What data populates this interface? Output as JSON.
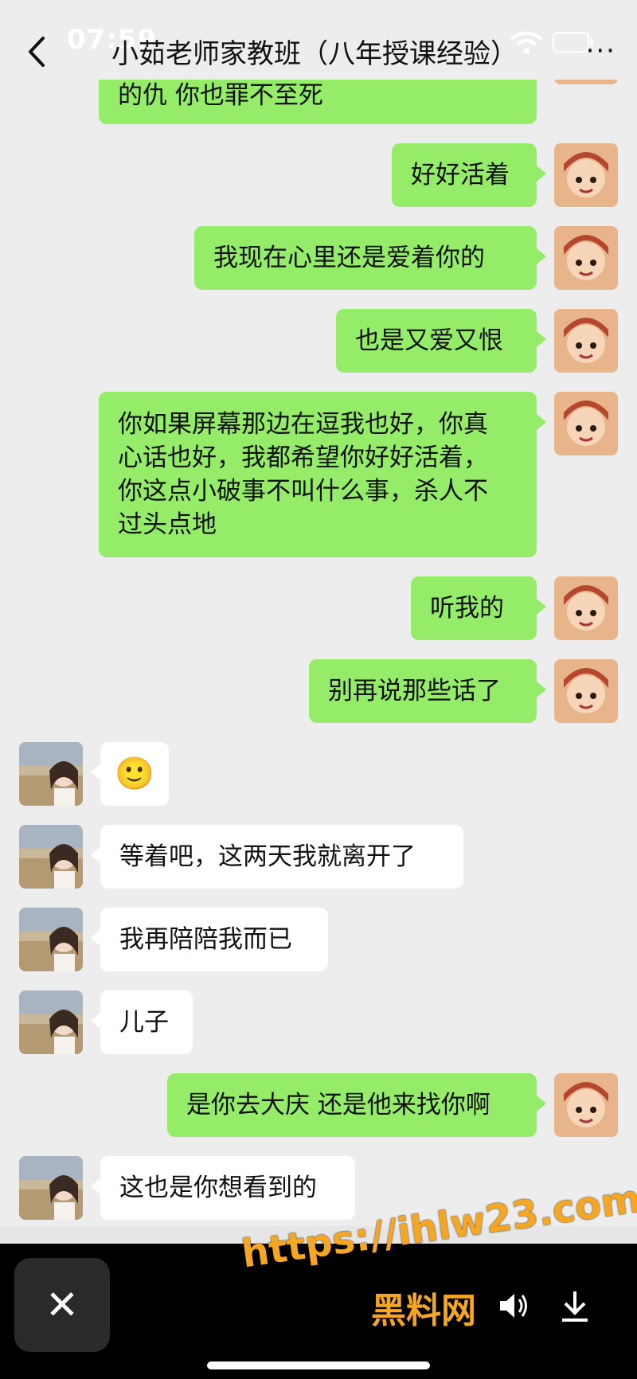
{
  "status_bar": {
    "time": "07:59"
  },
  "header": {
    "back_label": "<",
    "title": "小茹老师家教班（八年授课经验）",
    "more_label": "···"
  },
  "messages": [
    {
      "side": "out",
      "text": "的仇 你也罪不至死"
    },
    {
      "side": "out",
      "text": "好好活着"
    },
    {
      "side": "out",
      "text": "我现在心里还是爱着你的"
    },
    {
      "side": "out",
      "text": "也是又爱又恨"
    },
    {
      "side": "out",
      "lines": [
        "你如果屏幕那边在逗我也好，你真",
        "心话也好，我都希望你好好活着，",
        "你这点小破事不叫什么事，杀人不",
        "过头点地"
      ]
    },
    {
      "side": "out",
      "text": "听我的"
    },
    {
      "side": "out",
      "text": "别再说那些话了"
    },
    {
      "side": "in",
      "emoji": "🙂"
    },
    {
      "side": "in",
      "text": "等着吧，这两天我就离开了"
    },
    {
      "side": "in",
      "text": "我再陪陪我而已"
    },
    {
      "side": "in",
      "text": "儿子"
    },
    {
      "side": "out",
      "text": "是你去大庆 还是他来找你啊"
    },
    {
      "side": "in",
      "text": "这也是你想看到的"
    }
  ],
  "bottom_bar": {
    "close_label": "✕"
  },
  "watermark": {
    "url": "https://ihlw23.com",
    "site": "黑料网"
  },
  "colors": {
    "outgoing_bubble": "#95ec69",
    "incoming_bubble": "#ffffff",
    "background": "#ededed"
  },
  "icons": [
    "back-icon",
    "wifi-icon",
    "battery-icon",
    "more-icon",
    "close-icon",
    "speaker-icon",
    "download-icon"
  ]
}
